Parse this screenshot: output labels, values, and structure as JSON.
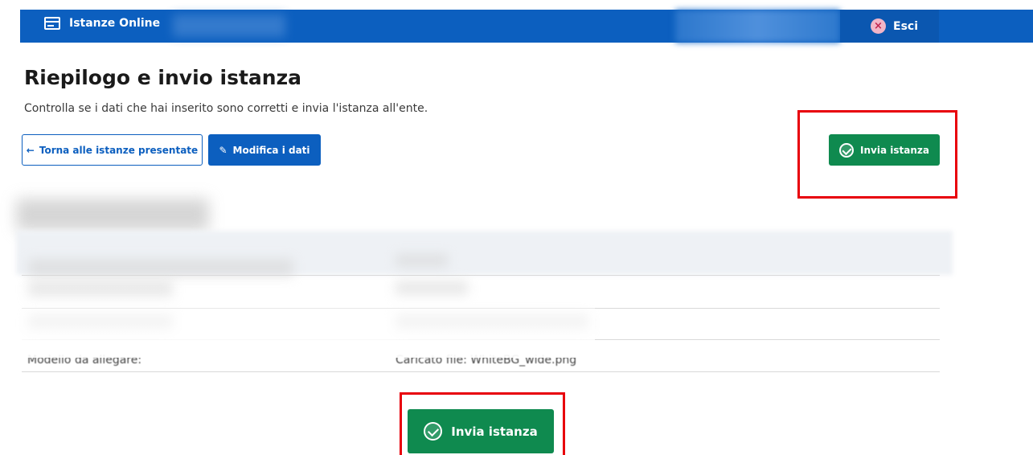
{
  "topbar": {
    "brand_label": "Istanze Online",
    "brand_icon": "form-icon",
    "exit_label": "Esci",
    "exit_icon": "close-circle-icon",
    "color": "#0c5fbf"
  },
  "header": {
    "title": "Riepilogo e invio istanza",
    "subtitle": "Controlla se i dati che hai inserito sono corretti e invia l'istanza all'ente."
  },
  "actions": {
    "back_label": "Torna alle istanze presentate",
    "back_icon": "arrow-left-icon",
    "edit_label": "Modifica i dati",
    "edit_icon": "pencil-icon",
    "send_label": "Invia istanza",
    "send_icon": "check-circle-icon",
    "send_color": "#0f8a4f"
  },
  "summary": {
    "rows": [
      {
        "label": "Modello da allegare:",
        "value": "Caricato file: WhiteBG_wide.png"
      }
    ]
  },
  "highlight_color": "#e8000b"
}
